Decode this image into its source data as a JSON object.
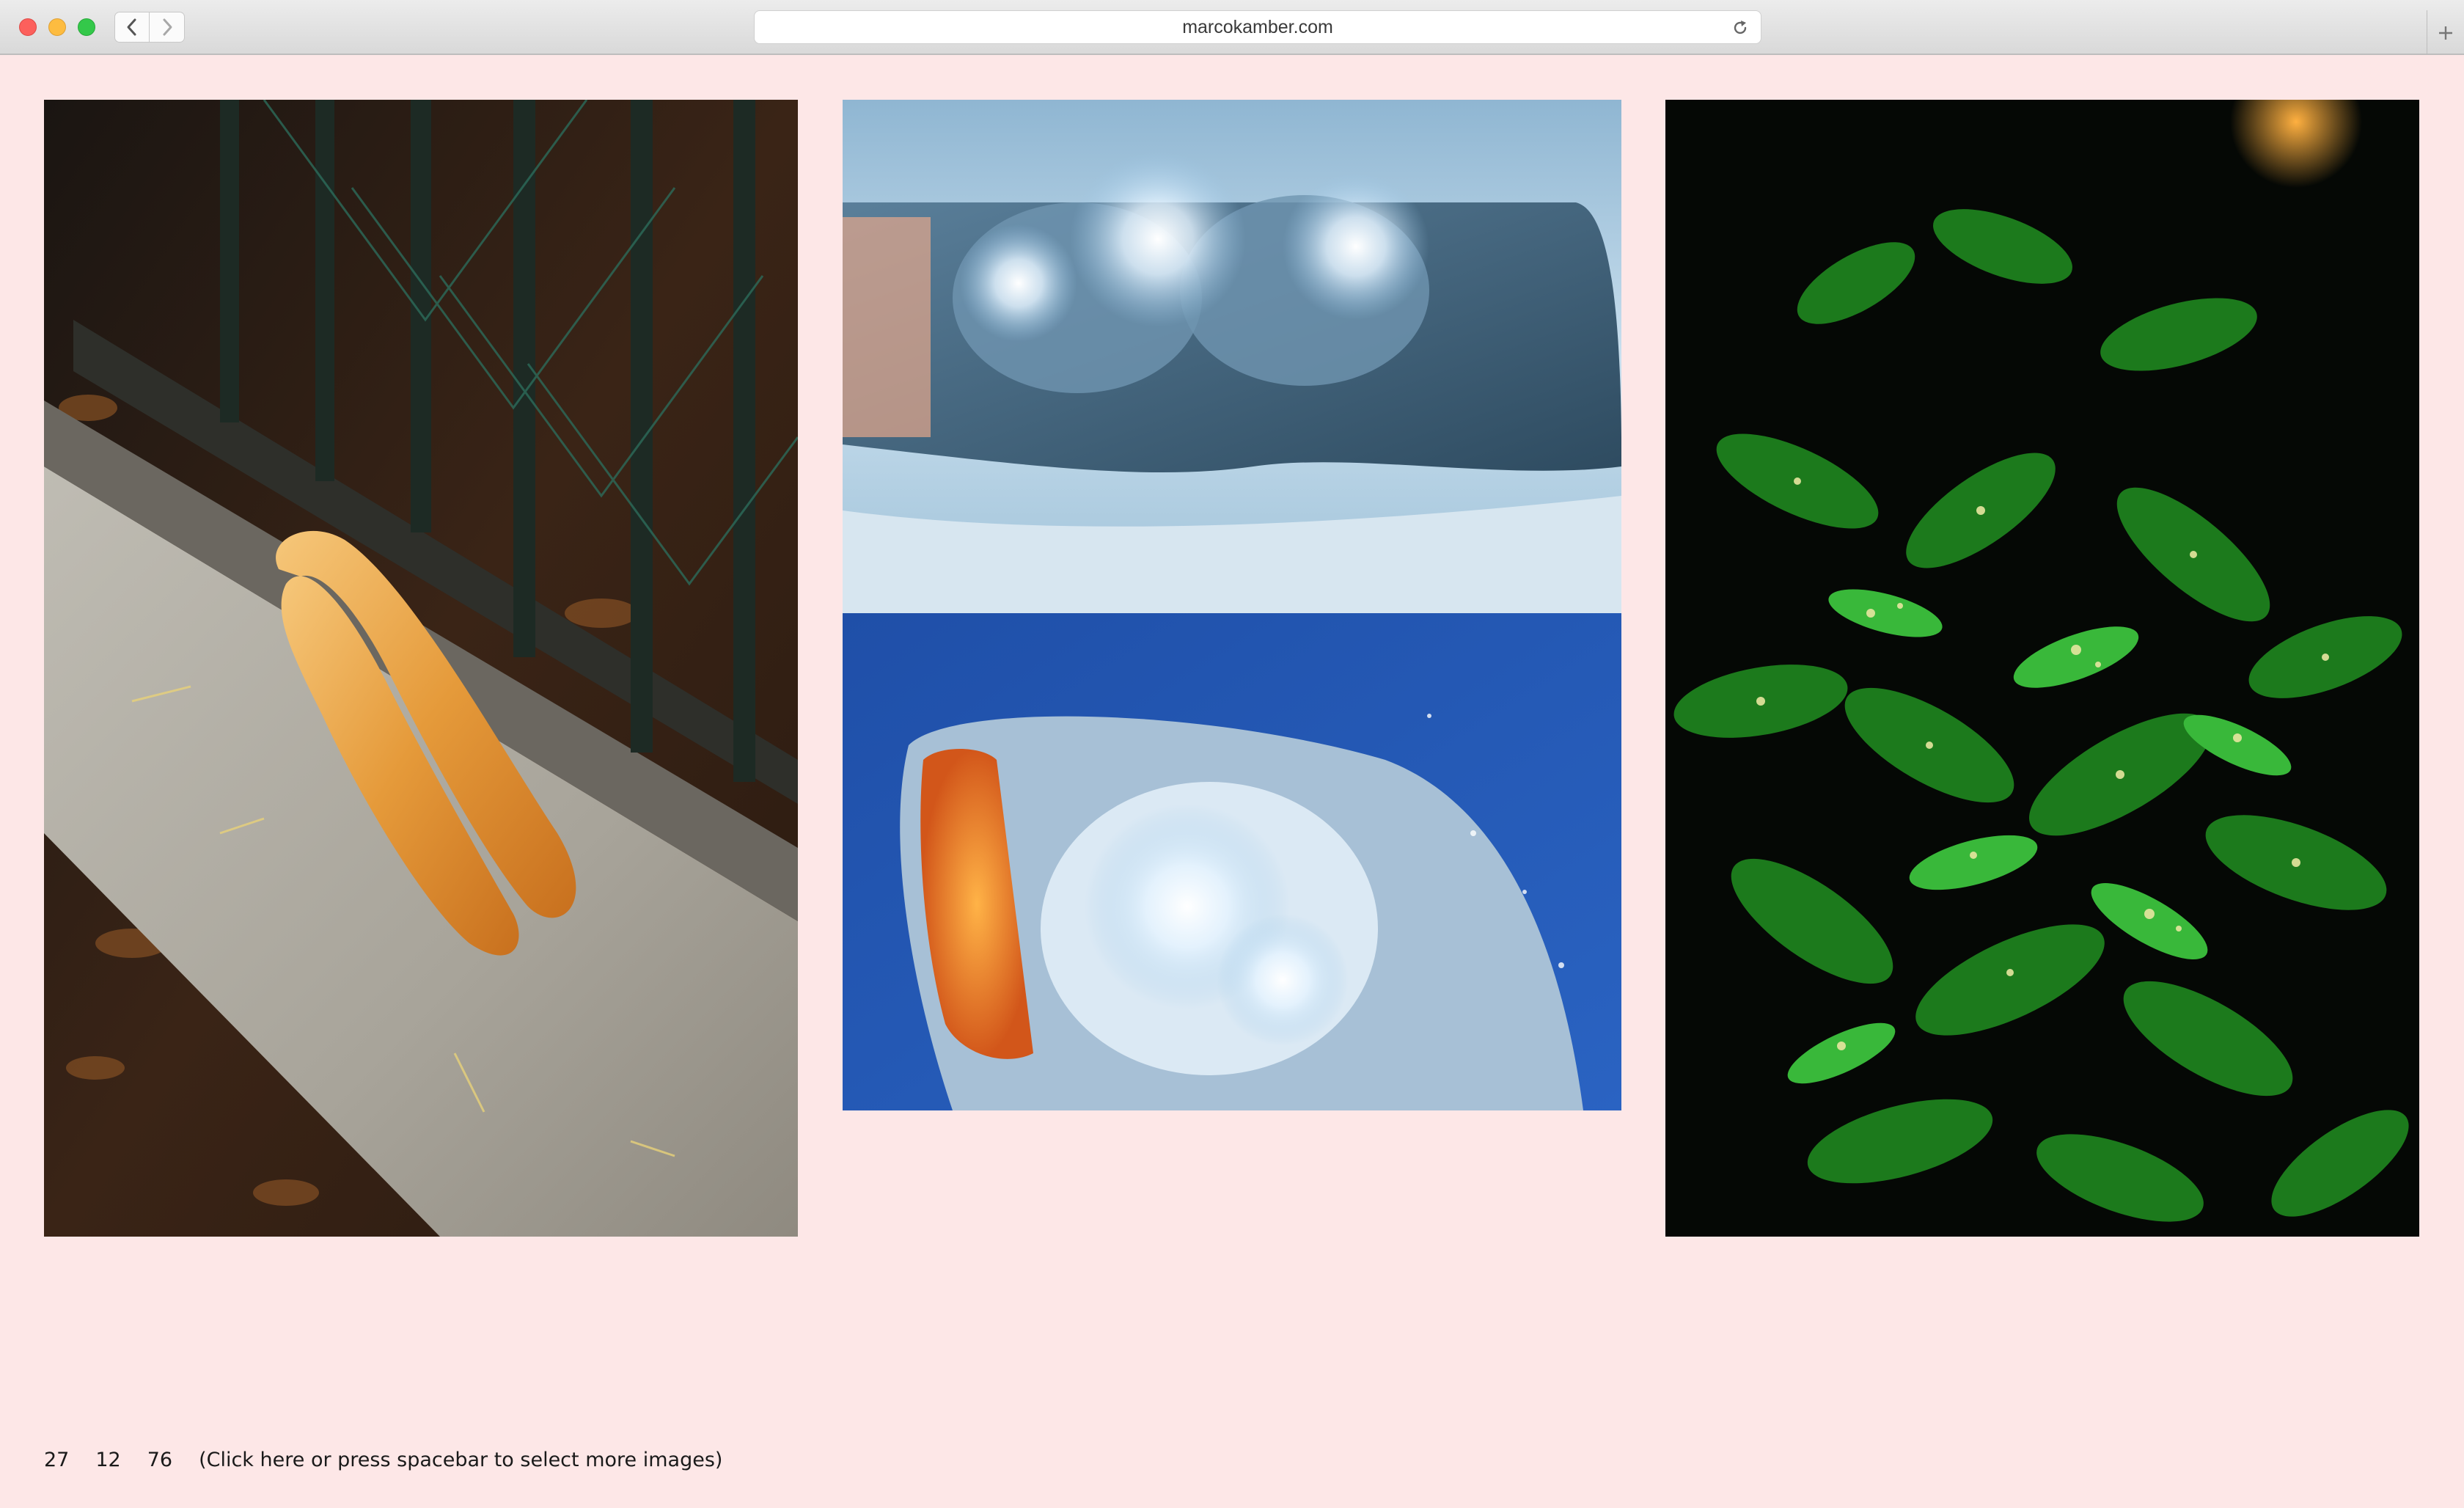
{
  "browser": {
    "url": "marcokamber.com",
    "icons": {
      "back": "chevron-left-icon",
      "forward": "chevron-right-icon",
      "reload": "reload-icon",
      "new_tab": "plus-icon"
    }
  },
  "gallery": {
    "images": [
      {
        "subject": "baguette"
      },
      {
        "subject": "headlights"
      },
      {
        "subject": "plant"
      }
    ]
  },
  "footer": {
    "numbers": [
      "27",
      "12",
      "76"
    ],
    "hint": "(Click here or press spacebar to select more images)"
  },
  "colors": {
    "page_background": "#fde7e7",
    "text": "#1a1a1a"
  }
}
